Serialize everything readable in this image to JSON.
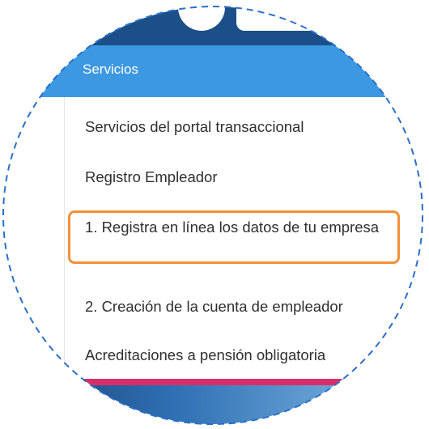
{
  "colors": {
    "banner": "#1c4f87",
    "header": "#3c98e0",
    "header_text": "#ffffff",
    "item_text": "#2f2f2f",
    "highlight": "#f0913a",
    "ring": "#2a6fc9",
    "accent": "#d82f6a"
  },
  "menu": {
    "header": "Servicios",
    "items": [
      {
        "label": "Servicios del portal transaccional"
      },
      {
        "label": "Registro Empleador"
      },
      {
        "label": "1. Registra en línea los datos de tu empresa"
      },
      {
        "label": "2. Creación de la cuenta de empleador"
      },
      {
        "label": "Acreditaciones a pensión obligatoria"
      }
    ]
  }
}
